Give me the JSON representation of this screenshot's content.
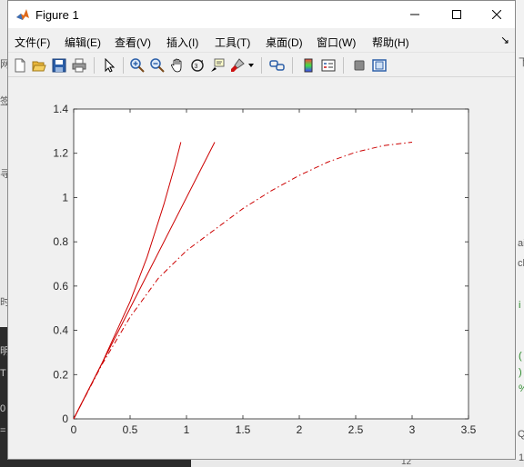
{
  "window": {
    "title": "Figure 1"
  },
  "menu": [
    {
      "label": "文件(F)"
    },
    {
      "label": "编辑(E)"
    },
    {
      "label": "查看(V)"
    },
    {
      "label": "插入(I)"
    },
    {
      "label": "工具(T)"
    },
    {
      "label": "桌面(D)"
    },
    {
      "label": "窗口(W)"
    },
    {
      "label": "帮助(H)"
    }
  ],
  "toolbar": [
    "new-figure-icon",
    "open-icon",
    "save-icon",
    "print-icon",
    "select-pointer-icon",
    "zoom-in-icon",
    "zoom-out-icon",
    "pan-hand-icon",
    "rotate-3d-icon",
    "data-cursor-icon",
    "brush-icon",
    "link-plot-icon",
    "colorbar-icon",
    "legend-icon",
    "hide-plot-tools-icon",
    "show-plot-tools-icon"
  ],
  "background_text": [
    "网",
    "签",
    "寻",
    "时",
    "明",
    "T",
    "0",
    "=",
    "12",
    "1",
    "ai",
    "ch",
    "(",
    ")",
    "%",
    "下",
    "Q",
    "i"
  ],
  "chart_data": {
    "type": "line",
    "title": "",
    "xlabel": "",
    "ylabel": "",
    "xlim": [
      0,
      3.5
    ],
    "ylim": [
      0,
      1.4
    ],
    "xticks": [
      "0",
      "0.5",
      "1",
      "1.5",
      "2",
      "2.5",
      "3",
      "3.5"
    ],
    "yticks": [
      "0",
      "0.2",
      "0.4",
      "0.6",
      "0.8",
      "1",
      "1.2",
      "1.4"
    ],
    "grid": false,
    "series": [
      {
        "style": "solid",
        "color": "#cc0000",
        "x": [
          0,
          0.25,
          0.5,
          0.65,
          0.8,
          0.9,
          0.95
        ],
        "y": [
          0,
          0.25,
          0.53,
          0.73,
          0.97,
          1.15,
          1.25
        ]
      },
      {
        "style": "solid",
        "color": "#cc0000",
        "x": [
          0,
          1.25
        ],
        "y": [
          0,
          1.25
        ]
      },
      {
        "style": "dashdot",
        "color": "#cc0000",
        "x": [
          0,
          0.25,
          0.5,
          0.75,
          1.0,
          1.25,
          1.5,
          1.75,
          2.0,
          2.25,
          2.5,
          2.75,
          3.0
        ],
        "y": [
          0,
          0.245,
          0.46,
          0.635,
          0.76,
          0.855,
          0.95,
          1.03,
          1.1,
          1.16,
          1.205,
          1.235,
          1.25
        ]
      }
    ]
  }
}
